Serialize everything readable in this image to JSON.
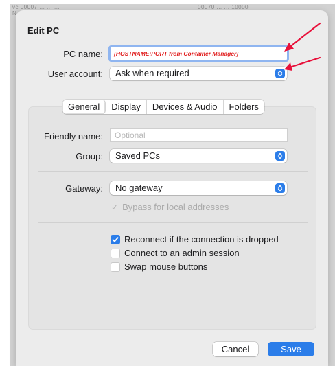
{
  "backdrop": {
    "line_left": "vc  00007  ...  ...  ...",
    "line_right": "00070  ...  ...  10000",
    "line_left_2": "N"
  },
  "dialog": {
    "title": "Edit PC",
    "pc_name": {
      "label": "PC name:",
      "value": "[HOSTNAME:PORT  from Container Manager]"
    },
    "user_account": {
      "label": "User account:",
      "value": "Ask when required"
    },
    "tabs": [
      {
        "label": "General",
        "active": true
      },
      {
        "label": "Display",
        "active": false
      },
      {
        "label": "Devices & Audio",
        "active": false
      },
      {
        "label": "Folders",
        "active": false
      }
    ],
    "general": {
      "friendly_name": {
        "label": "Friendly name:",
        "placeholder": "Optional"
      },
      "group": {
        "label": "Group:",
        "value": "Saved PCs"
      },
      "gateway": {
        "label": "Gateway:",
        "value": "No gateway"
      },
      "bypass": {
        "label": "Bypass for local addresses",
        "checked": true,
        "enabled": false
      },
      "options": [
        {
          "label": "Reconnect if the connection is dropped",
          "checked": true
        },
        {
          "label": "Connect to an admin session",
          "checked": false
        },
        {
          "label": "Swap mouse buttons",
          "checked": false
        }
      ]
    },
    "buttons": {
      "cancel": "Cancel",
      "save": "Save"
    }
  },
  "colors": {
    "accent": "#2b7de9",
    "annotation_arrow": "#e8103a",
    "annotation_text": "#e01c1c"
  },
  "icons": {
    "select_chevron": "chevron-up-down-icon",
    "checkmark": "checkmark-icon",
    "annotation": "red-arrow-icon"
  }
}
